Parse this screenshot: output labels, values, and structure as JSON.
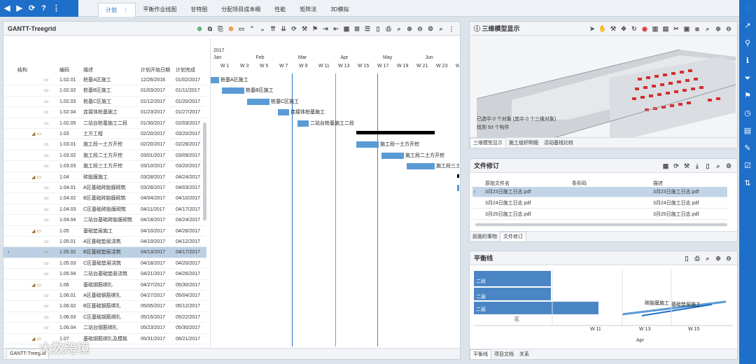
{
  "toolbar": {
    "back": "◀",
    "forward": "▶",
    "refresh": "⟳",
    "help": "?",
    "more": "⋮"
  },
  "tabs": [
    "计划",
    "平衡作业线图",
    "甘特图",
    "分配项目成本细",
    "性能",
    "矩阵法",
    "3D模拟"
  ],
  "tab_more": "⋮",
  "gantt": {
    "title": "GANTT-Treegrid",
    "year": "2017",
    "months": [
      "Jan",
      "Feb",
      "Mar",
      "Apr",
      "May",
      "Jun"
    ],
    "weeks": [
      "W 1",
      "W 3",
      "W 5",
      "W 7",
      "W 9",
      "W 11",
      "W 13",
      "W 15",
      "W 17",
      "W 19",
      "W 21",
      "W 23",
      "W"
    ],
    "columns": [
      "结构",
      "编码",
      "描述",
      "计划开始日期",
      "计划完成"
    ],
    "rows": [
      {
        "code": "1.02.01",
        "desc": "桩基A区施工",
        "start": "12/26/2016",
        "end": "01/02/2017",
        "type": "task"
      },
      {
        "code": "1.02.02",
        "desc": "桩基B区施工",
        "start": "01/03/2017",
        "end": "01/11/2017",
        "type": "task"
      },
      {
        "code": "1.02.03",
        "desc": "桩基C区施工",
        "start": "01/12/2017",
        "end": "01/20/2017",
        "type": "task"
      },
      {
        "code": "1.02.04",
        "desc": "连接体桩基施工",
        "start": "01/23/2017",
        "end": "01/27/2017",
        "type": "task"
      },
      {
        "code": "1.02.05",
        "desc": "二站台桩基施工二段",
        "start": "01/30/2017",
        "end": "02/03/2017",
        "type": "task"
      },
      {
        "code": "1.03",
        "desc": "土方工程",
        "start": "02/20/2017",
        "end": "03/20/2017",
        "type": "summary"
      },
      {
        "code": "1.03.01",
        "desc": "施工段一土方开挖",
        "start": "02/20/2017",
        "end": "02/28/2017",
        "type": "task"
      },
      {
        "code": "1.03.02",
        "desc": "施工段二土方开挖",
        "start": "03/01/2017",
        "end": "03/09/2017",
        "type": "task"
      },
      {
        "code": "1.03.03",
        "desc": "施工段三土方开挖",
        "start": "03/10/2017",
        "end": "03/20/2017",
        "type": "task"
      },
      {
        "code": "1.04",
        "desc": "砖胎膜施工",
        "start": "03/28/2017",
        "end": "04/24/2017",
        "type": "summary"
      },
      {
        "code": "1.04.01",
        "desc": "A区基础砖胎膜砌筑",
        "start": "03/28/2017",
        "end": "04/03/2017",
        "type": "task"
      },
      {
        "code": "1.04.02",
        "desc": "B区基础砖胎膜砌筑",
        "start": "04/04/2017",
        "end": "04/10/2017",
        "type": "task"
      },
      {
        "code": "1.04.03",
        "desc": "C区基础砖胎膜砌筑",
        "start": "04/11/2017",
        "end": "04/17/2017",
        "type": "task"
      },
      {
        "code": "1.04.04",
        "desc": "二站台基础砖胎膜砌筑",
        "start": "04/18/2017",
        "end": "04/24/2017",
        "type": "task"
      },
      {
        "code": "1.05",
        "desc": "基础垫层施工",
        "start": "04/10/2017",
        "end": "04/26/2017",
        "type": "summary"
      },
      {
        "code": "1.05.01",
        "desc": "A区基础垫层浇筑",
        "start": "04/10/2017",
        "end": "04/12/2017",
        "type": "task"
      },
      {
        "code": "1.05.02",
        "desc": "B区基础垫层浇筑",
        "start": "04/13/2017",
        "end": "04/17/2017",
        "type": "task",
        "selected": true
      },
      {
        "code": "1.05.03",
        "desc": "C区基础垫层浇筑",
        "start": "04/18/2017",
        "end": "04/20/2017",
        "type": "task"
      },
      {
        "code": "1.05.04",
        "desc": "二站台基础垫层浇筑",
        "start": "04/21/2017",
        "end": "04/26/2017",
        "type": "task"
      },
      {
        "code": "1.06",
        "desc": "基础钢筋绑扎",
        "start": "04/27/2017",
        "end": "05/30/2017",
        "type": "summary"
      },
      {
        "code": "1.06.01",
        "desc": "A区基础钢筋绑扎",
        "start": "04/27/2017",
        "end": "05/04/2017",
        "type": "task"
      },
      {
        "code": "1.06.02",
        "desc": "B区基础钢筋绑扎",
        "start": "05/05/2017",
        "end": "05/12/2017",
        "type": "task"
      },
      {
        "code": "1.06.03",
        "desc": "C区基础钢筋绑扎",
        "start": "05/15/2017",
        "end": "05/22/2017",
        "type": "task"
      },
      {
        "code": "1.06.04",
        "desc": "二站台钢筋绑扎",
        "start": "05/23/2017",
        "end": "05/30/2017",
        "type": "task"
      },
      {
        "code": "1.07",
        "desc": "基础钢筋绑扎及模板",
        "start": "05/31/2017",
        "end": "06/21/2017",
        "type": "summary"
      }
    ],
    "tab_label": "GANTT-Treegrid"
  },
  "model3d": {
    "title": "三维模型显示",
    "line1": "已选中 0 个对象 (其中 0 个三维对象)",
    "line2": "找到 93 个构件",
    "tabs": [
      "三维模型显示",
      "施工组织明细",
      "活动基线比较"
    ]
  },
  "files": {
    "title": "文件修订",
    "columns": [
      "原始文件名",
      "条形码",
      "描述"
    ],
    "rows": [
      {
        "name": "3月23日施工日志.pdf",
        "code": "",
        "desc": "3月23日施工日志.pdf"
      },
      {
        "name": "3月24日施工日志.pdf",
        "code": "",
        "desc": "3月24日施工日志.pdf"
      },
      {
        "name": "3月25日施工日志.pdf",
        "code": "",
        "desc": "3月25日施工日志.pdf"
      }
    ],
    "tabs": [
      "前面的事物",
      "文件修订"
    ]
  },
  "balance": {
    "title": "平衡线",
    "labels": [
      "二段",
      "二层",
      "二层",
      "区"
    ],
    "weeks": [
      "W 11",
      "W 13",
      "W 15"
    ],
    "month": "Apr",
    "annot1": "砖胎膜施工",
    "annot2": "基础垫层施工",
    "tabs": [
      "平衡线",
      "项目文档",
      "关系"
    ]
  },
  "watermark": "大数跨境",
  "colors": {
    "accent": "#1e6fc9",
    "bar": "#5b9bd5",
    "orange": "#e8861a",
    "green": "#3aa34a"
  }
}
